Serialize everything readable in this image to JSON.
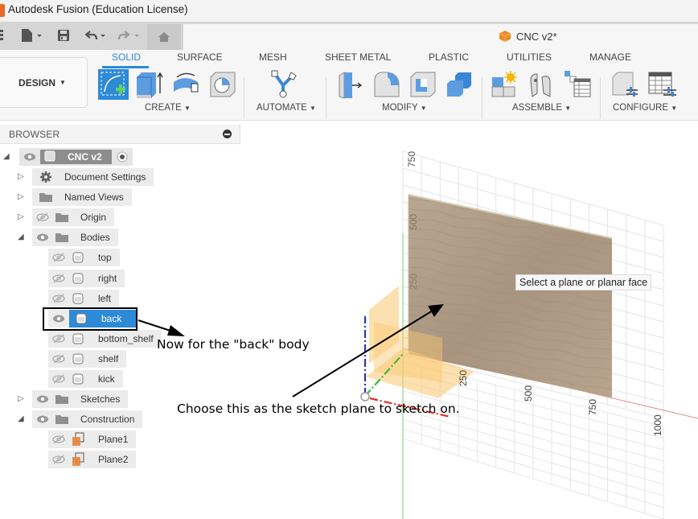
{
  "window": {
    "title": "Autodesk Fusion (Education License)"
  },
  "quick_access": {
    "icons": [
      "grid-menu-icon",
      "file-icon",
      "save-icon",
      "undo-icon",
      "redo-icon",
      "home-icon"
    ]
  },
  "document_tab": {
    "title": "CNC v2*"
  },
  "toolbar": {
    "workspace_label": "DESIGN",
    "tabs": [
      {
        "label": "SOLID",
        "active": true
      },
      {
        "label": "SURFACE",
        "active": false
      },
      {
        "label": "MESH",
        "active": false
      },
      {
        "label": "SHEET METAL",
        "active": false
      },
      {
        "label": "PLASTIC",
        "active": false
      },
      {
        "label": "UTILITIES",
        "active": false
      },
      {
        "label": "MANAGE",
        "active": false
      }
    ],
    "groups": [
      {
        "label": "CREATE",
        "tools": [
          "create-sketch",
          "extrude",
          "revolve",
          "hole"
        ]
      },
      {
        "label": "AUTOMATE",
        "tools": [
          "automate"
        ]
      },
      {
        "label": "MODIFY",
        "tools": [
          "press-pull",
          "fillet",
          "shell",
          "combine"
        ]
      },
      {
        "label": "ASSEMBLE",
        "tools": [
          "new-component",
          "joint",
          "bill-of-materials"
        ]
      },
      {
        "label": "CONFIGURE",
        "tools": [
          "configure-model",
          "configuration-table"
        ]
      }
    ]
  },
  "browser": {
    "title": "BROWSER",
    "root": {
      "label": "CNC v2"
    },
    "items": [
      {
        "label": "Document Settings",
        "icon": "gear",
        "expander": "collapsed",
        "eye": "none"
      },
      {
        "label": "Named Views",
        "icon": "folder",
        "expander": "collapsed",
        "eye": "none"
      },
      {
        "label": "Origin",
        "icon": "folder",
        "expander": "collapsed",
        "eye": "hidden"
      },
      {
        "label": "Bodies",
        "icon": "folder",
        "expander": "expanded",
        "eye": "visible"
      },
      {
        "label": "top",
        "icon": "body",
        "eye": "hidden"
      },
      {
        "label": "right",
        "icon": "body",
        "eye": "hidden"
      },
      {
        "label": "left",
        "icon": "body",
        "eye": "hidden"
      },
      {
        "label": "back",
        "icon": "body",
        "eye": "visible",
        "selected": true
      },
      {
        "label": "bottom_shelf",
        "icon": "body",
        "eye": "hidden"
      },
      {
        "label": "shelf",
        "icon": "body",
        "eye": "hidden"
      },
      {
        "label": "kick",
        "icon": "body",
        "eye": "hidden"
      },
      {
        "label": "Sketches",
        "icon": "folder",
        "expander": "collapsed",
        "eye": "visible"
      },
      {
        "label": "Construction",
        "icon": "folder",
        "expander": "expanded",
        "eye": "visible"
      },
      {
        "label": "Plane1",
        "icon": "plane",
        "eye": "hidden"
      },
      {
        "label": "Plane2",
        "icon": "plane",
        "eye": "hidden"
      }
    ]
  },
  "viewport": {
    "tooltip": "Select a plane or planar face",
    "grid_labels_vertical": [
      "750",
      "500",
      "250"
    ],
    "grid_labels_horizontal": [
      "250",
      "500",
      "750",
      "1000"
    ],
    "axis_colors": {
      "x": "#e03030",
      "y": "#3db83d",
      "z": "#2a35c0"
    }
  },
  "annotations": {
    "back_note": "Now for the \"back\" body",
    "plane_note": "Choose this as the sketch plane to sketch on."
  }
}
